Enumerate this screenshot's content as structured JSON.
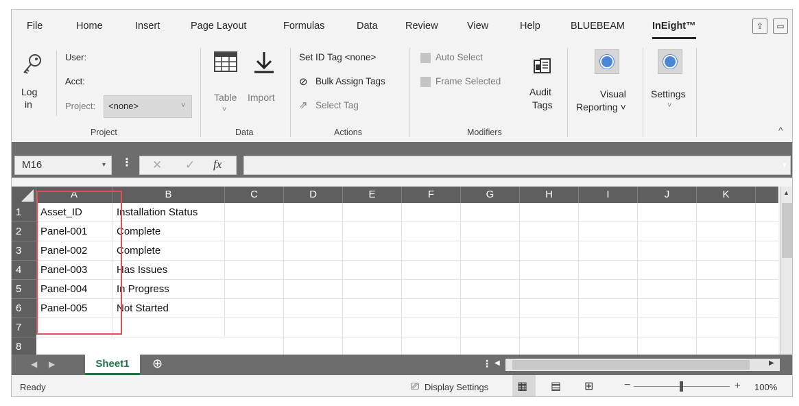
{
  "ribbon_tabs": [
    "File",
    "Home",
    "Insert",
    "Page Layout",
    "Formulas",
    "Data",
    "Review",
    "View",
    "Help",
    "BLUEBEAM",
    "InEight™"
  ],
  "project_group": {
    "login_label_1": "Log",
    "login_label_2": "in",
    "user_label": "User:",
    "acct_label": "Acct:",
    "project_label": "Project:",
    "project_value": "<none>",
    "group_label": "Project"
  },
  "data_group": {
    "table_label": "Table",
    "import_label": "Import",
    "group_label": "Data"
  },
  "actions_group": {
    "set_id_tag": "Set ID Tag  <none>",
    "bulk_assign": "Bulk Assign Tags",
    "select_tag": "Select Tag",
    "group_label": "Actions"
  },
  "modifiers_group": {
    "auto_select": "Auto Select",
    "frame_selected": "Frame Selected",
    "group_label": "Modifiers"
  },
  "audit": {
    "label_1": "Audit",
    "label_2": "Tags"
  },
  "visual_reporting": {
    "label_1": "Visual",
    "label_2": "Reporting ˅"
  },
  "settings": {
    "label": "Settings"
  },
  "name_box": "M16",
  "fx_label": "fx",
  "columns": [
    "A",
    "B",
    "C",
    "D",
    "E",
    "F",
    "G",
    "H",
    "I",
    "J",
    "K"
  ],
  "rows": [
    [
      "Asset_ID",
      "Installation Status"
    ],
    [
      "Panel-001",
      "Complete"
    ],
    [
      "Panel-002",
      "Complete"
    ],
    [
      "Panel-003",
      "Has Issues"
    ],
    [
      "Panel-004",
      "In Progress"
    ],
    [
      "Panel-005",
      "Not Started"
    ],
    [
      "",
      ""
    ]
  ],
  "row_numbers": [
    "1",
    "2",
    "3",
    "4",
    "5",
    "6",
    "7",
    "8"
  ],
  "sheet_tab": "Sheet1",
  "status": {
    "ready": "Ready",
    "display_settings": "Display Settings",
    "zoom": "100%"
  }
}
